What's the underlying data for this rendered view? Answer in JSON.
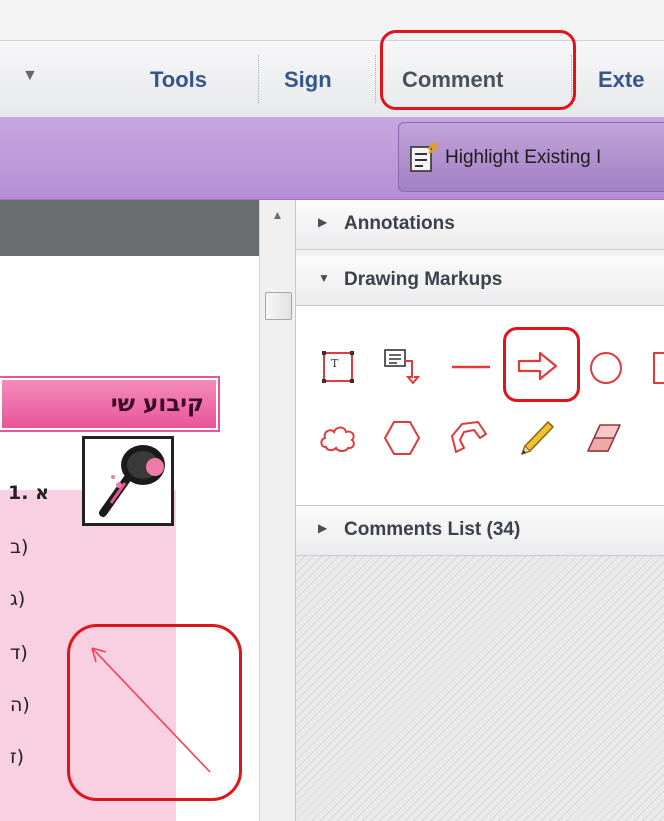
{
  "toolbar": {
    "tabs": [
      {
        "label": "Tools"
      },
      {
        "label": "Sign"
      },
      {
        "label": "Comment"
      },
      {
        "label": "Exte"
      }
    ]
  },
  "ribbon": {
    "highlight_button_label": "Highlight Existing I"
  },
  "document": {
    "title": "קיבוע שי",
    "lines": [
      "1. א",
      "ב)",
      "ג)",
      "ד)",
      "ה)",
      "ז)"
    ]
  },
  "panels": {
    "annotations": "Annotations",
    "drawing_markups": "Drawing Markups",
    "comments_list": "Comments List (34)"
  },
  "drawing_tools": [
    {
      "name": "text-box-icon"
    },
    {
      "name": "text-callout-icon"
    },
    {
      "name": "line-icon"
    },
    {
      "name": "arrow-icon"
    },
    {
      "name": "oval-icon"
    },
    {
      "name": "rectangle-icon"
    },
    {
      "name": "cloud-icon"
    },
    {
      "name": "polygon-icon"
    },
    {
      "name": "connected-lines-icon"
    },
    {
      "name": "pencil-icon"
    },
    {
      "name": "eraser-icon"
    }
  ],
  "colors": {
    "callout_red": "#e0151c",
    "ribbon_purple": "#b78ed6",
    "markup_red": "#e03a3a",
    "tab_blue": "#34568b"
  }
}
